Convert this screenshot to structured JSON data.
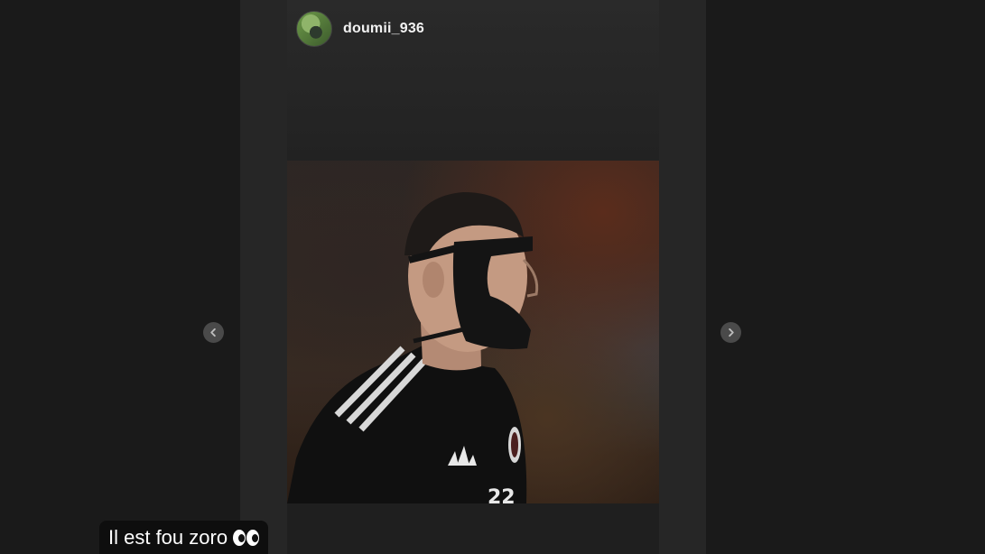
{
  "story": {
    "username": "doumii_936",
    "caption_text": "Il est fou zoro",
    "caption_emoji": "eyes-icon"
  },
  "navigation": {
    "prev_icon": "chevron-left-icon",
    "next_icon": "chevron-right-icon"
  },
  "colors": {
    "background": "#1a1a1a",
    "story_background": "#1f1f1f",
    "caption_background": "#0e0e0e",
    "text": "#f2f2f2"
  }
}
